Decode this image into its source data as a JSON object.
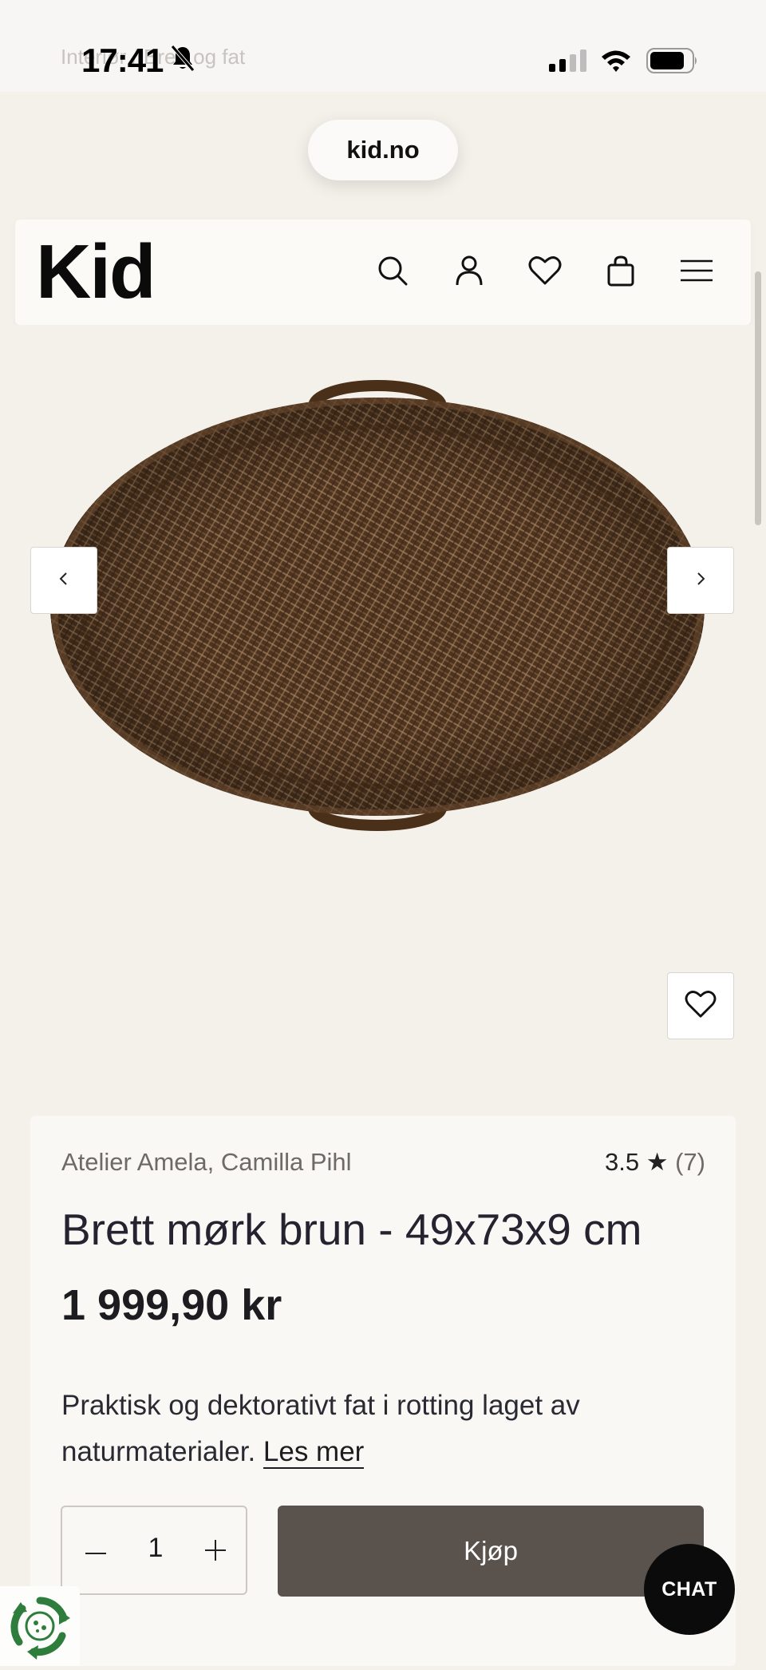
{
  "status_bar": {
    "time": "17:41",
    "ghost_text": "Interiør / Brett og fat"
  },
  "browser": {
    "url": "kid.no"
  },
  "header": {
    "logo": "Kid",
    "icons": [
      "search-icon",
      "user-icon",
      "heart-icon",
      "bag-icon",
      "menu-icon"
    ]
  },
  "gallery": {
    "prev_icon": "chevron-left-icon",
    "next_icon": "chevron-right-icon",
    "wishlist_icon": "heart-icon"
  },
  "product": {
    "brand": "Atelier Amela, Camilla Pihl",
    "rating": "3.5 ★",
    "rating_count": "(7)",
    "title": "Brett mørk brun - 49x73x9 cm",
    "price": "1 999,90 kr",
    "description": "Praktisk og dektorativt fat i rotting laget av naturmaterialer.",
    "read_more": "Les mer",
    "quantity": "1",
    "buy_label": "Kjøp"
  },
  "chat": {
    "label": "CHAT"
  },
  "colors": {
    "background": "#f4f0ea",
    "card": "#faf8f5",
    "buy_button": "#5a524d",
    "chat_button": "#0b0b0b",
    "recycle_green": "#2f7d3c"
  }
}
